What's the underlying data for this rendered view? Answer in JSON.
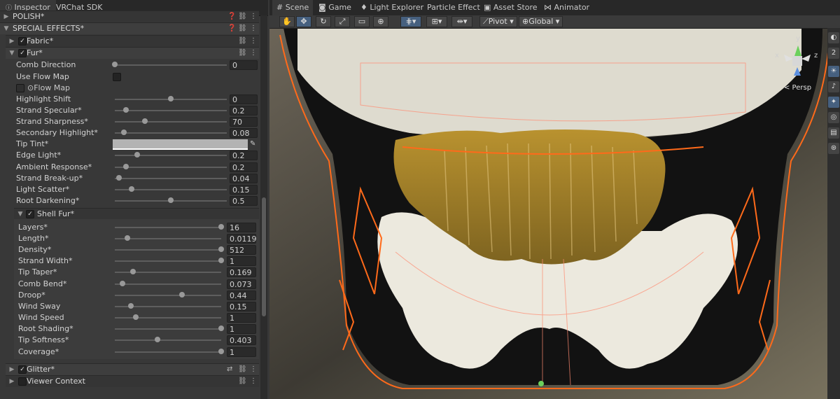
{
  "inspector": {
    "tabs": [
      "Inspector",
      "VRChat SDK"
    ],
    "sections": {
      "polish": "POLISH*",
      "special_effects": "SPECIAL EFFECTS*",
      "fabric": "Fabric*",
      "fur": "Fur*",
      "shell_fur": "Shell Fur*",
      "glitter": "Glitter*",
      "viewer_context": "Viewer Context"
    },
    "fur_props": {
      "comb_direction": {
        "label": "Comb Direction",
        "value": "0",
        "level": 0.0
      },
      "use_flow_map": {
        "label": "Use Flow Map"
      },
      "flow_map": {
        "label": "Flow Map"
      },
      "highlight_shift": {
        "label": "Highlight Shift",
        "value": "0",
        "level": 0.5
      },
      "strand_specular": {
        "label": "Strand Specular*",
        "value": "0.2",
        "level": 0.1
      },
      "strand_sharpness": {
        "label": "Strand Sharpness*",
        "value": "70",
        "level": 0.27
      },
      "secondary_highlight": {
        "label": "Secondary Highlight*",
        "value": "0.08",
        "level": 0.08
      },
      "tip_tint": {
        "label": "Tip Tint*"
      },
      "edge_light": {
        "label": "Edge Light*",
        "value": "0.2",
        "level": 0.2
      },
      "ambient_response": {
        "label": "Ambient Response*",
        "value": "0.2",
        "level": 0.1
      },
      "strand_breakup": {
        "label": "Strand Break-up*",
        "value": "0.04",
        "level": 0.04
      },
      "light_scatter": {
        "label": "Light Scatter*",
        "value": "0.15",
        "level": 0.15
      },
      "root_darkening": {
        "label": "Root Darkening*",
        "value": "0.5",
        "level": 0.5
      }
    },
    "shell_props": {
      "layers": {
        "label": "Layers*",
        "value": "16",
        "level": 1.0
      },
      "length": {
        "label": "Length*",
        "value": "0.0119",
        "level": 0.12
      },
      "density": {
        "label": "Density*",
        "value": "512",
        "level": 1.0
      },
      "strand_width": {
        "label": "Strand Width*",
        "value": "1",
        "level": 1.0
      },
      "tip_taper": {
        "label": "Tip Taper*",
        "value": "0.169",
        "level": 0.17
      },
      "comb_bend": {
        "label": "Comb Bend*",
        "value": "0.073",
        "level": 0.07
      },
      "droop": {
        "label": "Droop*",
        "value": "0.44",
        "level": 0.63
      },
      "wind_sway": {
        "label": "Wind Sway",
        "value": "0.15",
        "level": 0.15
      },
      "wind_speed": {
        "label": "Wind Speed",
        "value": "1",
        "level": 0.2
      },
      "root_shading": {
        "label": "Root Shading*",
        "value": "1",
        "level": 1.0
      },
      "tip_softness": {
        "label": "Tip Softness*",
        "value": "0.403",
        "level": 0.4
      },
      "coverage": {
        "label": "Coverage*",
        "value": "1",
        "level": 1.0
      }
    }
  },
  "scene": {
    "tabs": [
      "Scene",
      "Game",
      "Light Explorer",
      "Particle Effect",
      "Asset Store",
      "Animator"
    ],
    "toolbar": {
      "pivot": "Pivot",
      "global": "Global"
    },
    "gizmo": {
      "persp": "< Persp",
      "axis_x": "x",
      "axis_y": "y",
      "axis_z": "z"
    }
  },
  "colors": {
    "accent": "#46607f",
    "panel": "#383838",
    "wire": "#ff6a1a"
  }
}
